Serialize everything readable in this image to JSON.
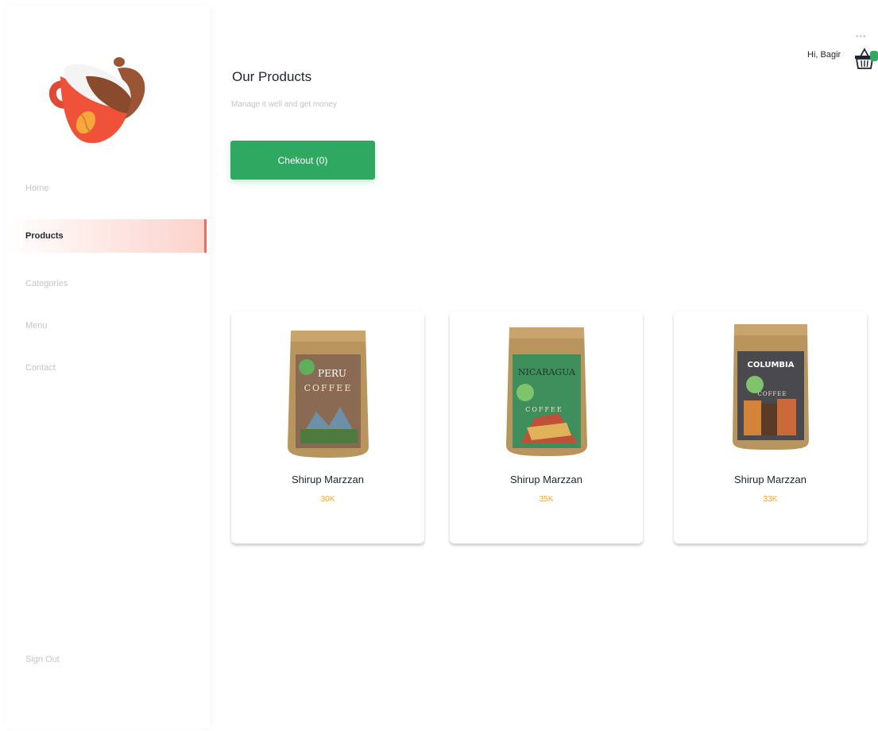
{
  "sidebar": {
    "items": [
      {
        "label": "Home",
        "active": false
      },
      {
        "label": "Products",
        "active": true
      },
      {
        "label": "Categories",
        "active": false
      },
      {
        "label": "Menu",
        "active": false
      },
      {
        "label": "Contact",
        "active": false
      }
    ],
    "signout_label": "Sign Out"
  },
  "header": {
    "title": "Our Products",
    "subtitle": "Manage it well and get money",
    "checkout_label": "Chekout (0)",
    "greeting": "Hi, Bagir",
    "more_dots": "•••"
  },
  "products": [
    {
      "name": "Shirup Marzzan",
      "price": "30K",
      "pack_label": "PERU",
      "pack_sub": "COFFEE",
      "pack_color": "#8a6a52"
    },
    {
      "name": "Shirup Marzzan",
      "price": "35K",
      "pack_label": "NICARAGUA",
      "pack_sub": "COFFEE",
      "pack_color": "#3f8f5c"
    },
    {
      "name": "Shirup Marzzan",
      "price": "33K",
      "pack_label": "COLUMBIA",
      "pack_sub": "COFFEE",
      "pack_color": "#4a4a4e"
    }
  ],
  "colors": {
    "accent": "#2fa862",
    "active_indicator": "#f26b5b",
    "price": "#f2a530",
    "text_dark": "#1f2430",
    "text_muted": "#c4c4c4"
  }
}
